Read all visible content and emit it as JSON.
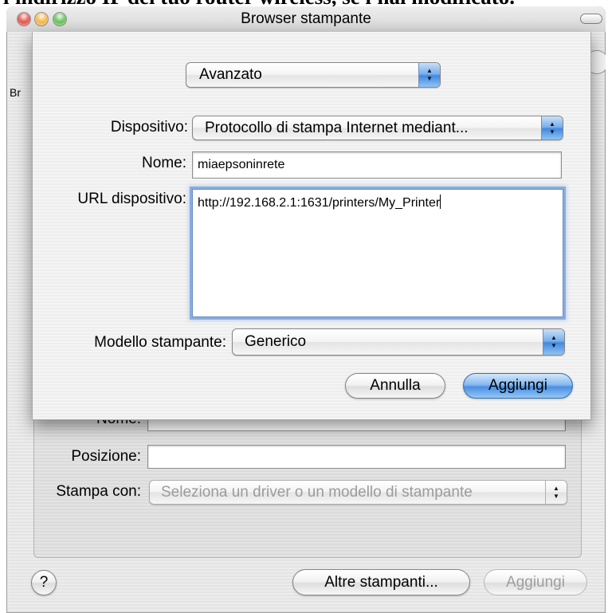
{
  "page_heading_fragment": "l'indirizzo IP del tuo router wireless, se l'hai modificato.",
  "colors": {
    "close": "#e2483f",
    "minimize": "#f3b33d",
    "zoom": "#5cbf4a",
    "accent": "#4a8fe2",
    "focus_ring": "#7ca6de"
  },
  "window": {
    "title": "Browser stampante",
    "toolbar_label_fragment": "Br",
    "form": {
      "name_label": "Nome:",
      "location_label": "Posizione:",
      "print_with_label": "Stampa con:",
      "print_with_value": "Seleziona un driver o un modello di stampante"
    },
    "footer": {
      "help_label": "?",
      "more_printers_label": "Altre stampanti...",
      "add_label": "Aggiungi"
    }
  },
  "sheet": {
    "mode_popup": "Avanzato",
    "device_label": "Dispositivo:",
    "device_value": "Protocollo di stampa Internet mediant...",
    "name_label": "Nome:",
    "name_value": "miaepsoninrete",
    "url_label": "URL dispositivo:",
    "url_value": "http://192.168.2.1:1631/printers/My_Printer",
    "model_label": "Modello stampante:",
    "model_value": "Generico",
    "cancel_label": "Annulla",
    "add_label": "Aggiungi"
  }
}
